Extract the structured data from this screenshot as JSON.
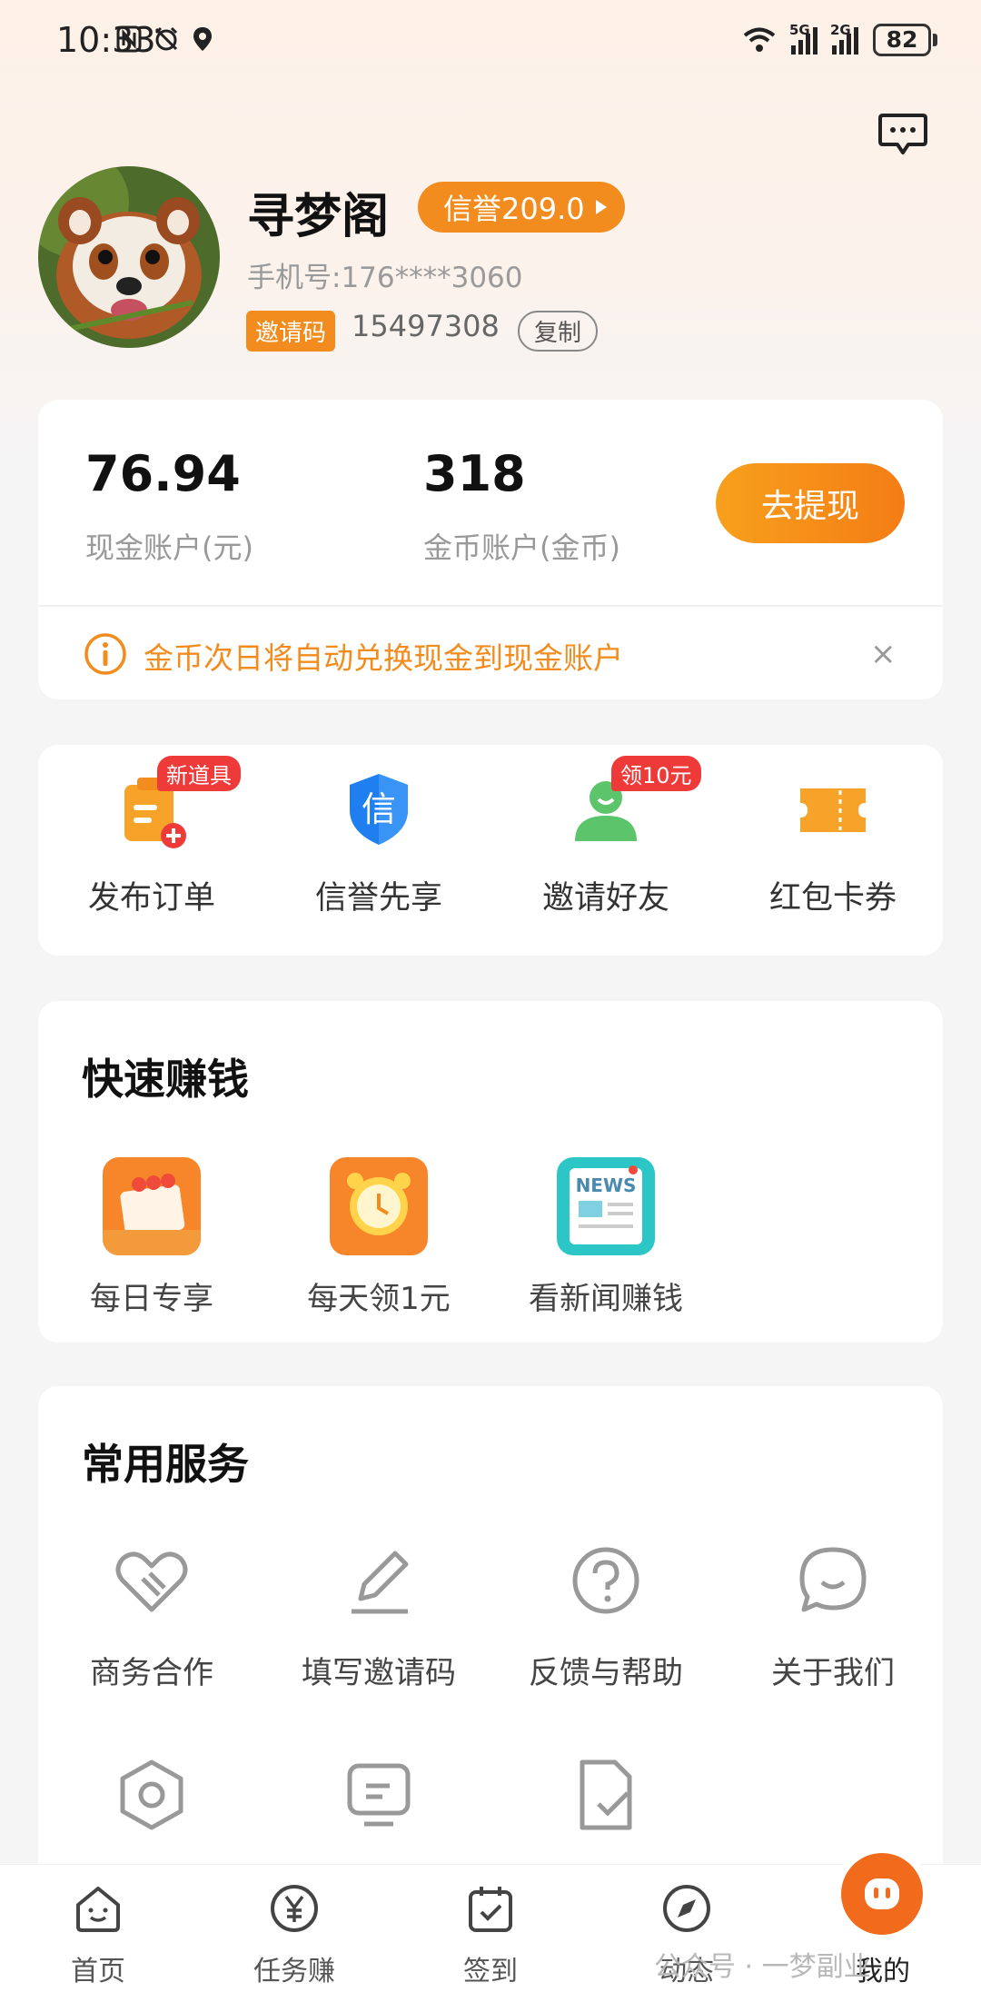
{
  "status_bar": {
    "time": "10:33",
    "sig1_label": "5G",
    "sig2_label": "2G",
    "battery": "82"
  },
  "profile": {
    "name": "寻梦阁",
    "credit": "信誉209.0",
    "phone": "手机号:176****3060",
    "invite_tag": "邀请码",
    "invite_code": "15497308",
    "copy_label": "复制"
  },
  "balance": {
    "cash_value": "76.94",
    "cash_label": "现金账户(元)",
    "coin_value": "318",
    "coin_label": "金币账户(金币)",
    "withdraw_label": "去提现",
    "notice": "金币次日将自动兑换现金到现金账户",
    "close_glyph": "×"
  },
  "shortcuts": [
    {
      "label": "发布订单",
      "badge": "新道具"
    },
    {
      "label": "信誉先享",
      "icon_text": "信"
    },
    {
      "label": "邀请好友",
      "badge": "领10元"
    },
    {
      "label": "红包卡券"
    }
  ],
  "quick_earn": {
    "title": "快速赚钱",
    "items": [
      {
        "label": "每日专享"
      },
      {
        "label": "每天领1元"
      },
      {
        "label": "看新闻赚钱",
        "icon_text": "NEWS"
      }
    ]
  },
  "services": {
    "title": "常用服务",
    "items": [
      {
        "label": "商务合作"
      },
      {
        "label": "填写邀请码"
      },
      {
        "label": "反馈与帮助"
      },
      {
        "label": "关于我们"
      }
    ]
  },
  "bottom_nav": [
    {
      "label": "首页"
    },
    {
      "label": "任务赚"
    },
    {
      "label": "签到"
    },
    {
      "label": "动态"
    },
    {
      "label": "我的"
    }
  ],
  "watermark": "公众号 · 一梦副业",
  "colors": {
    "accent": "#f28c1e",
    "badge_red": "#ef3a3a",
    "blue": "#1f7ff0",
    "green": "#5cc46a"
  }
}
